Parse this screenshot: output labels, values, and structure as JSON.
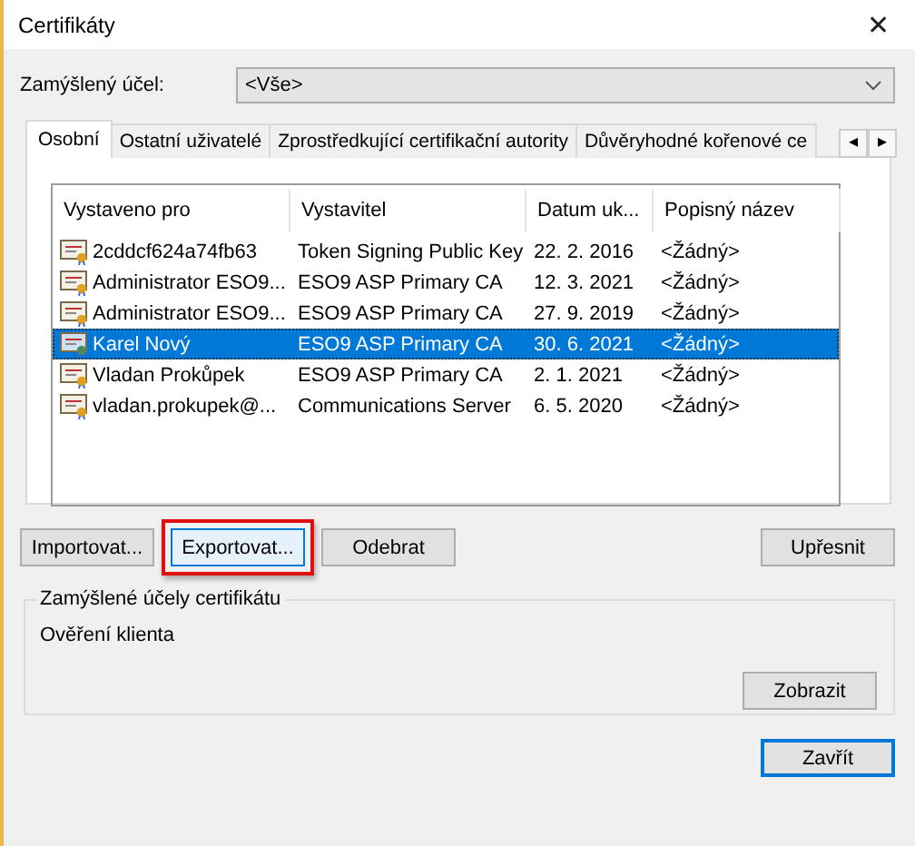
{
  "window": {
    "title": "Certifikáty",
    "close": "✕"
  },
  "purpose": {
    "label": "Zamýšlený účel:",
    "value": "<Vše>"
  },
  "tabs": [
    {
      "label": "Osobní",
      "selected": true
    },
    {
      "label": "Ostatní uživatelé",
      "selected": false
    },
    {
      "label": "Zprostředkující certifikační autority",
      "selected": false
    },
    {
      "label": "Důvěryhodné kořenové ce",
      "selected": false
    }
  ],
  "tab_scroll": [
    "◂",
    "▸"
  ],
  "table": {
    "columns": [
      "Vystaveno pro",
      "Vystavitel",
      "Datum uk...",
      "Popisný název"
    ],
    "rows": [
      {
        "cells": [
          "2cddcf624a74fb63",
          "Token Signing Public Key",
          "22. 2. 2016",
          "<Žádný>"
        ],
        "selected": false
      },
      {
        "cells": [
          "Administrator ESO9...",
          "ESO9 ASP Primary CA",
          "12. 3. 2021",
          "<Žádný>"
        ],
        "selected": false
      },
      {
        "cells": [
          "Administrator ESO9...",
          "ESO9 ASP Primary CA",
          "27. 9. 2019",
          "<Žádný>"
        ],
        "selected": false
      },
      {
        "cells": [
          "Karel Nový",
          "ESO9 ASP Primary CA",
          "30. 6. 2021",
          "<Žádný>"
        ],
        "selected": true
      },
      {
        "cells": [
          "Vladan Prokůpek",
          "ESO9 ASP Primary CA",
          "2. 1. 2021",
          "<Žádný>"
        ],
        "selected": false
      },
      {
        "cells": [
          "vladan.prokupek@...",
          "Communications Server",
          "6. 5. 2020",
          "<Žádný>"
        ],
        "selected": false
      }
    ]
  },
  "actions": [
    {
      "label": "Importovat...",
      "highlighted": false
    },
    {
      "label": "Exportovat...",
      "highlighted": true
    },
    {
      "label": "Odebrat",
      "highlighted": false
    }
  ],
  "advanced": {
    "label": "Upřesnit"
  },
  "purposes_group": {
    "title": "Zamýšlené účely certifikátu",
    "text": "Ověření klienta",
    "button": "Zobrazit"
  },
  "close_button": {
    "label": "Zavřít",
    "focused": true
  }
}
